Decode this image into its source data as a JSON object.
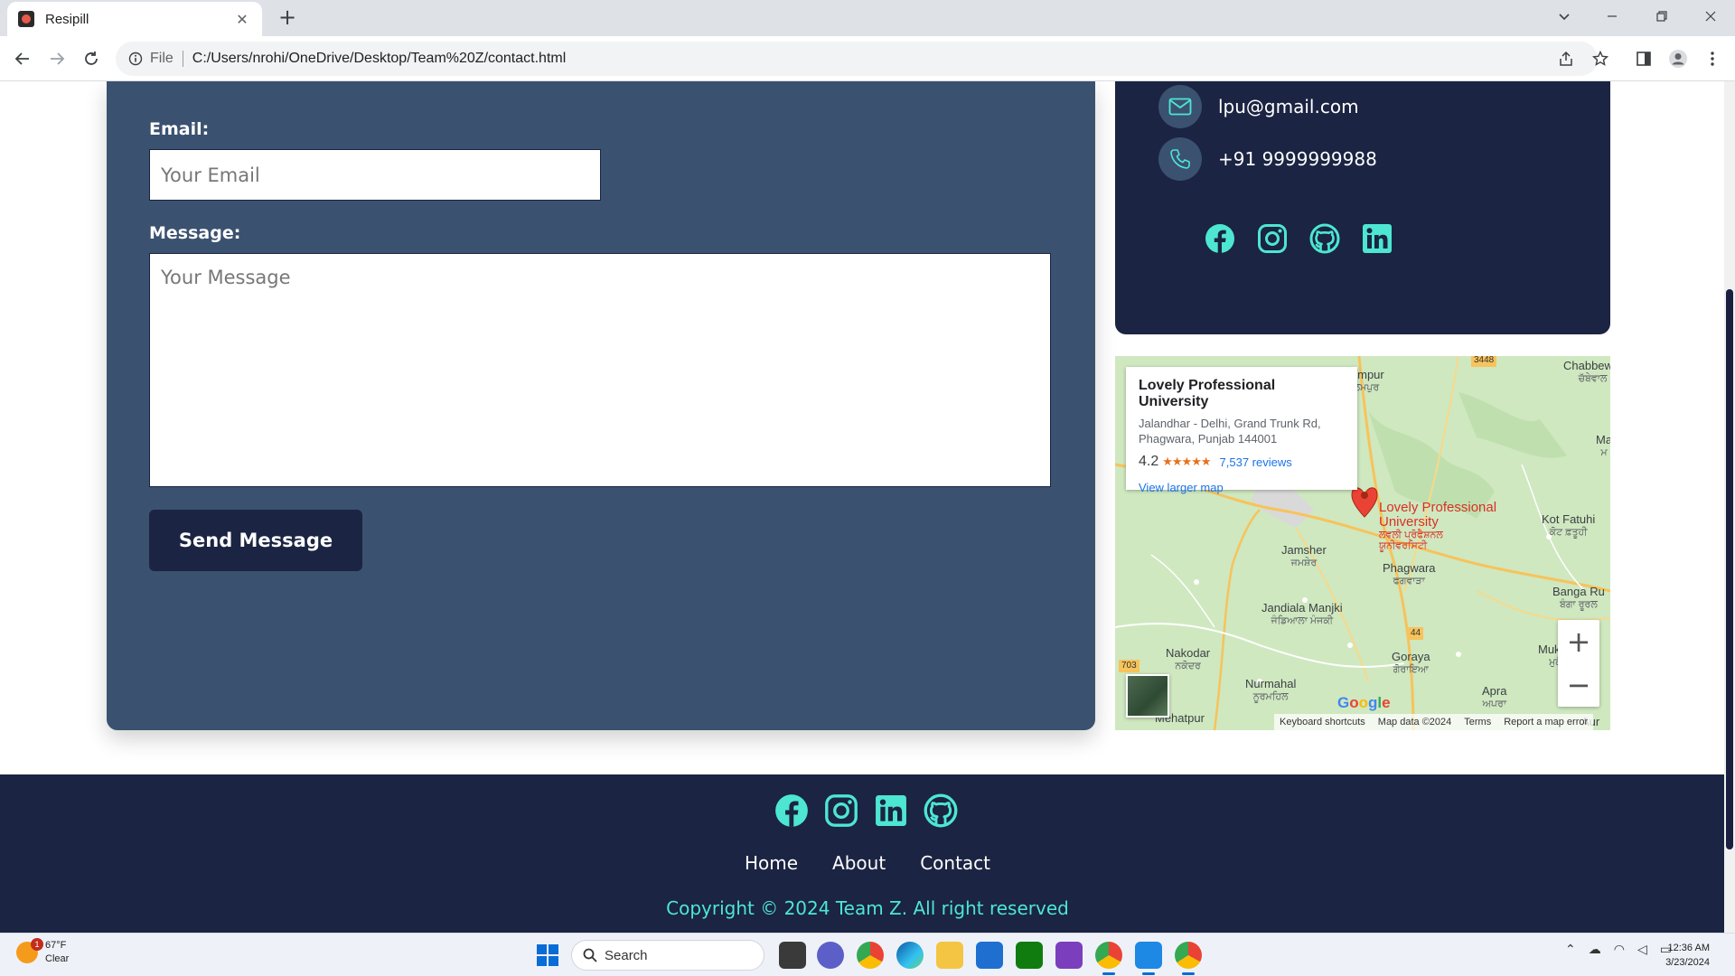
{
  "browser": {
    "tab_title": "Resipill",
    "tab_close": "✕",
    "new_tab": "+",
    "file_label": "File",
    "url": "C:/Users/nrohi/OneDrive/Desktop/Team%20Z/contact.html"
  },
  "form": {
    "email_label": "Email:",
    "email_placeholder": "Your Email",
    "message_label": "Message:",
    "message_placeholder": "Your Message",
    "send_button": "Send Message"
  },
  "contact_info": {
    "email": "lpu@gmail.com",
    "phone": "+91 9999999988",
    "social_icons": [
      "facebook-icon",
      "instagram-icon",
      "github-icon",
      "linkedin-icon"
    ]
  },
  "map": {
    "popup": {
      "title": "Lovely Professional University",
      "address_line1": "Jalandhar - Delhi, Grand Trunk Rd,",
      "address_line2": "Phagwara, Punjab 144001",
      "rating": "4.2",
      "stars": "★★★★★",
      "reviews": "7,537 reviews",
      "view_larger": "View larger map"
    },
    "pin_label": {
      "line1": "Lovely Professional",
      "line2": "University",
      "line3": "ਲਵਲੀ ਪ੍ਰੋਫੈਸ਼ਨਲ",
      "line4": "ਯੂਨੀਵਰਸਿਟੀ"
    },
    "towns": [
      {
        "name": "lampur",
        "local": "ਲਮਪੁਰ"
      },
      {
        "name": "Chabbewal",
        "local": "ਚੱਬੇਵਾਲ"
      },
      {
        "name": "Jamsher",
        "local": "ਜਮਸ਼ੇਰ"
      },
      {
        "name": "Phagwara",
        "local": "ਫਗਵਾੜਾ"
      },
      {
        "name": "Kot Fatuhi",
        "local": "ਕੋਟ ਫ਼ਤੂਹੀ"
      },
      {
        "name": "Jandiala Manjki",
        "local": "ਜੰਡਿਆਲਾ ਮੰਜਕੀ"
      },
      {
        "name": "Banga Ru",
        "local": "ਬੰਗਾ ਰੂਰਲ"
      },
      {
        "name": "Nakodar",
        "local": "ਨਕੋਦਰ"
      },
      {
        "name": "Goraya",
        "local": "ਗੋਰਾਇਆ"
      },
      {
        "name": "Mukand",
        "local": "ਮੁਕੰਦ"
      },
      {
        "name": "Nurmahal",
        "local": "ਨੂਰਮਹਿਲ"
      },
      {
        "name": "Apra",
        "local": "ਅਪਰਾ"
      },
      {
        "name": "Mehatpur",
        "local": ""
      },
      {
        "name": "Aur",
        "local": ""
      },
      {
        "name": "Ma",
        "local": "ਮ"
      }
    ],
    "road_badges": [
      "3448",
      "44",
      "703"
    ],
    "zoom_in": "+",
    "zoom_out": "−",
    "google": [
      "G",
      "o",
      "o",
      "g",
      "l",
      "e"
    ],
    "footer": {
      "shortcuts": "Keyboard shortcuts",
      "data": "Map data ©2024",
      "terms": "Terms",
      "report": "Report a map error"
    }
  },
  "footer": {
    "nav": [
      "Home",
      "About",
      "Contact"
    ],
    "copyright": "Copyright © 2024 Team Z. All right reserved",
    "social_icons": [
      "facebook-icon",
      "instagram-icon",
      "linkedin-icon",
      "github-icon"
    ]
  },
  "taskbar": {
    "weather_temp": "67°F",
    "weather_cond": "Clear",
    "weather_badge": "1",
    "search_label": "Search",
    "time": "12:36 AM",
    "date": "3/23/2024"
  },
  "colors": {
    "form_bg": "#3b5170",
    "dark_navy": "#1b2442",
    "accent_teal": "#4de6d3"
  }
}
